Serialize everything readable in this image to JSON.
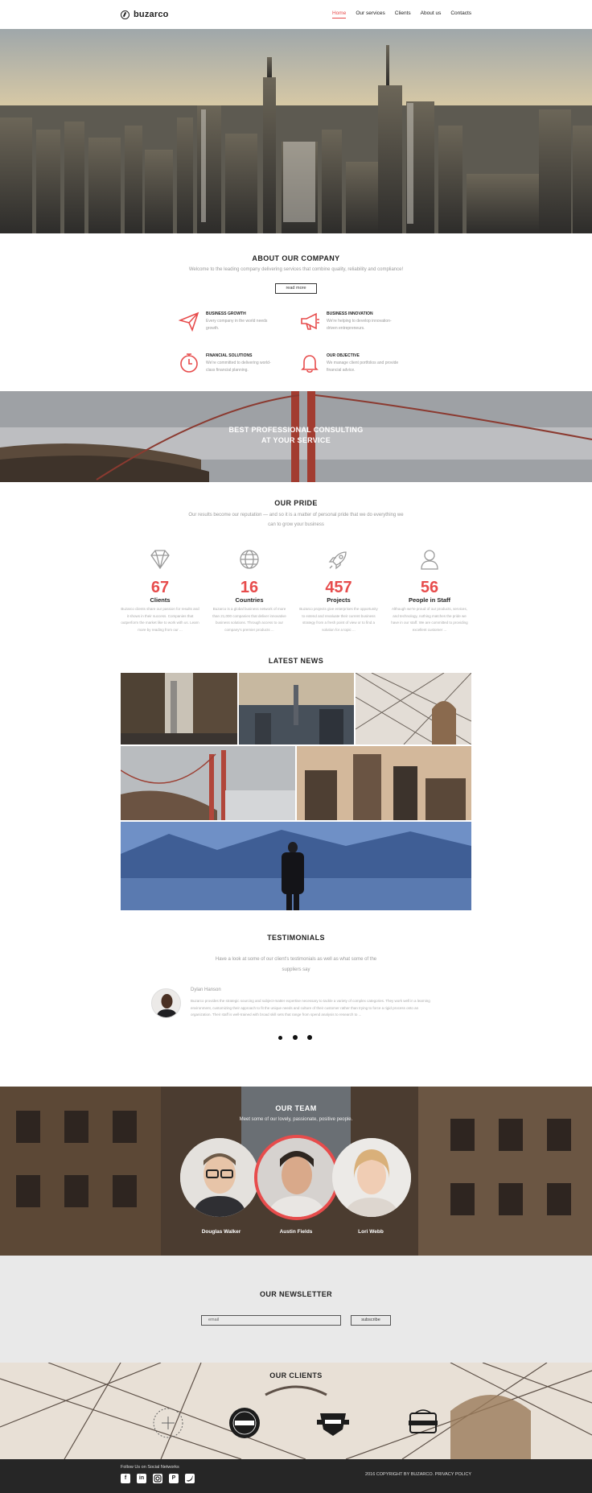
{
  "header": {
    "logo": "buzarco",
    "nav": [
      "Home",
      "Our services",
      "Clients",
      "About us",
      "Contacts"
    ]
  },
  "about": {
    "title": "ABOUT OUR COMPANY",
    "subtitle": "Welcome to the leading company delivering services that combine quality, reliability and compliance!",
    "button": "read more",
    "features": [
      {
        "icon": "paper-plane-icon",
        "title": "BUSINESS GROWTH",
        "text": "Every company in the world needs growth."
      },
      {
        "icon": "megaphone-icon",
        "title": "BUSINESS INNOVATION",
        "text": "We're helping to develop innovation-driven entrepreneurs."
      },
      {
        "icon": "stopwatch-icon",
        "title": "FINANCIAL SOLUTIONS",
        "text": "We're committed to delivering world-class financial planning."
      },
      {
        "icon": "bell-icon",
        "title": "OUR OBJECTIVE",
        "text": "We manage client portfolios and provide financial advice."
      }
    ]
  },
  "banner": {
    "line1": "BEST PROFESSIONAL CONSULTING",
    "line2": "AT YOUR SERVICE"
  },
  "pride": {
    "title": "OUR PRIDE",
    "subtitle_line1": "Our results become our reputation — and so it is a matter of personal pride that we do everything we",
    "subtitle_line2": "can to grow your business",
    "stats": [
      {
        "icon": "diamond-icon",
        "value": "67",
        "label": "Clients",
        "text": "Buzarco clients share our passion for results and it shows in their success. Companies that outperform the market like to work with us. Learn more by reading from our ..."
      },
      {
        "icon": "globe-icon",
        "value": "16",
        "label": "Countries",
        "text": "Buzarco is a global business network of more than 21,000 companies that deliver innovative business solutions. Through access to our company's premier products ..."
      },
      {
        "icon": "rocket-icon",
        "value": "457",
        "label": "Projects",
        "text": "Buzarco projects give enterprises the opportunity to extend and revaluate their current business strategy from a fresh point of view or to find a solution for a topic ..."
      },
      {
        "icon": "user-icon",
        "value": "56",
        "label": "People in Staff",
        "text": "Although we're proud of our products, services, and technology, nothing matches the pride we have in our staff. We are committed to providing excellent customer ..."
      }
    ]
  },
  "news": {
    "title": "LATEST NEWS"
  },
  "testimonials": {
    "title": "TESTIMONIALS",
    "subtitle_line1": "Have a look at some of our client's testimonials as well as what some of the",
    "subtitle_line2": "suppliers say",
    "name": "Dylan Hanson",
    "text": "Buzarco provides the strategic sourcing and subject-matter expertise necessary to tackle a variety of complex categories. They work well in a learning environment, customizing their approach to fit the unique needs and culture of their customer rather than trying to force a rigid process onto an organization. Their staff is well-trained with broad skill sets that range from spend analysis to research to ..."
  },
  "team": {
    "title": "OUR TEAM",
    "subtitle": "Meet some of our lovely, passionate, positive people.",
    "members": [
      "Douglas Walker",
      "Austin Fields",
      "Lori Webb"
    ]
  },
  "newsletter": {
    "title": "OUR NEWSLETTER",
    "placeholder": "email",
    "button": "subscribe"
  },
  "clients": {
    "title": "OUR CLIENTS"
  },
  "footer": {
    "follow": "Follow Us on Social Networks",
    "social": [
      "facebook-icon",
      "linkedin-icon",
      "instagram-icon",
      "pinterest-icon",
      "twitter-icon"
    ],
    "copyright": "2016 COPYRIGHT BY BUZARCO. PRIVACY POLICY"
  },
  "colors": {
    "accent": "#e74c4c",
    "dark": "#222222",
    "footer": "#262626",
    "newsletter_bg": "#e9e9e9"
  }
}
